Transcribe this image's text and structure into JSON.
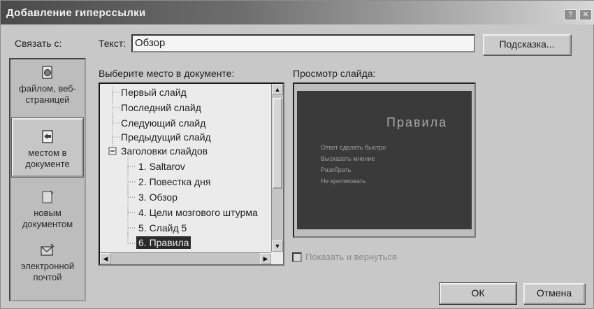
{
  "window": {
    "title": "Добавление гиперссылки"
  },
  "link_to": {
    "label": "Связать с:",
    "items": [
      {
        "label_l1": "файлом, веб-",
        "label_l2": "страницей"
      },
      {
        "label_l1": "местом в",
        "label_l2": "документе"
      },
      {
        "label_l1": "новым",
        "label_l2": "документом"
      },
      {
        "label_l1": "электронной",
        "label_l2": "почтой"
      }
    ]
  },
  "text_field": {
    "label": "Текст:",
    "value": "Обзор"
  },
  "hint_button": "Подсказка...",
  "place": {
    "label": "Выберите место в документе:",
    "items": [
      "Первый слайд",
      "Последний слайд",
      "Следующий слайд",
      "Предыдущий слайд",
      "Заголовки слайдов",
      "1. Saltarov",
      "2. Повестка дня",
      "3. Обзор",
      "4. Цели мозгового штурма",
      "5. Слайд 5",
      "6. Правила"
    ],
    "selected_index": 10
  },
  "preview": {
    "label": "Просмотр слайда:",
    "slide_title": "Правила",
    "slide_lines": [
      "Ответ сделать быстро",
      "Высказать мнение",
      "Разобрать",
      "Не критиковать"
    ]
  },
  "show_and_return": {
    "label": "Показать и вернуться",
    "checked": false
  },
  "ok_button": "ОК",
  "cancel_button": "Отмена"
}
